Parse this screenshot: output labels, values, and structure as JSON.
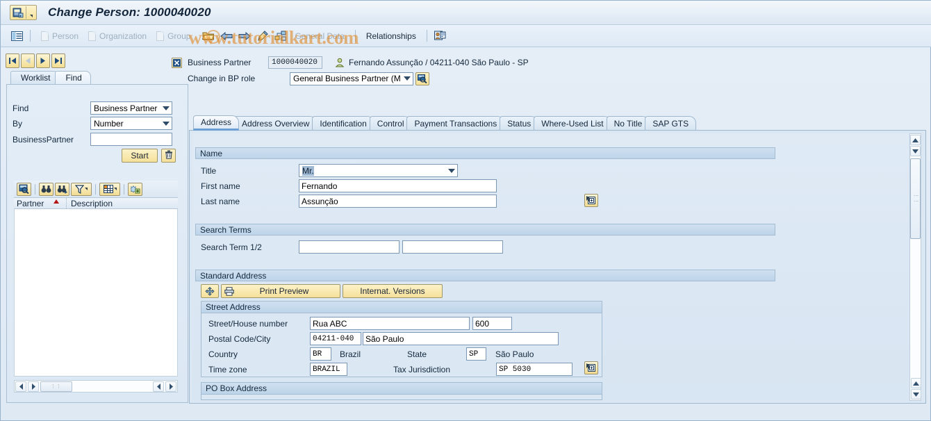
{
  "window": {
    "title": "Change Person: 1000040020",
    "sysmenu_icon": "bp-person-icon",
    "sysmenu_arrow_icon": "menu-dropdown-arrow-icon"
  },
  "watermark": {
    "text": "www.tutorialkart.com"
  },
  "app_toolbar": {
    "list_icon": "list-view-icon",
    "items": [
      {
        "label": "Person",
        "icon": "document-icon",
        "enabled": false
      },
      {
        "label": "Organization",
        "icon": "document-icon",
        "enabled": false
      },
      {
        "label": "Group",
        "icon": "document-icon",
        "enabled": false
      }
    ],
    "open_icon": "open-folder-icon",
    "back_icon": "left-arrow-icon",
    "forward_icon": "right-arrow-icon",
    "edit_icon": "pencil-edit-icon",
    "hierarchy_icon": "relationship-node-icon",
    "general_data_label": "General Data",
    "relationships_label": "Relationships",
    "bp_role_icon": "business-partner-card-icon"
  },
  "nav_buttons": [
    {
      "name": "first-record-button",
      "icon": "first-icon",
      "enabled": true
    },
    {
      "name": "previous-record-button",
      "icon": "previous-icon",
      "enabled": false
    },
    {
      "name": "next-record-button",
      "icon": "next-icon",
      "enabled": true
    },
    {
      "name": "last-record-button",
      "icon": "last-icon",
      "enabled": true
    }
  ],
  "left_panel": {
    "tabs": [
      {
        "label": "Worklist",
        "active": false
      },
      {
        "label": "Find",
        "active": true
      }
    ],
    "find_label": "Find",
    "find_value": "Business Partner",
    "by_label": "By",
    "by_value": "Number",
    "bp_label": "BusinessPartner",
    "bp_value": "",
    "start_label": "Start",
    "delete_icon": "trash-can-icon",
    "grid_toolbar": [
      {
        "name": "detail-search-button",
        "icon": "magnifier-detail-icon"
      },
      {
        "name": "find-button",
        "icon": "binoculars-icon"
      },
      {
        "name": "find-next-button",
        "icon": "binoculars-next-icon"
      },
      {
        "name": "filter-button",
        "icon": "filter-icon"
      },
      {
        "name": "layout-button",
        "icon": "table-layout-icon"
      },
      {
        "name": "refresh-button",
        "icon": "refresh-star-icon"
      }
    ],
    "columns": [
      "Partner",
      "Description"
    ],
    "rows": []
  },
  "bp_header": {
    "close_icon": "close-x-icon",
    "business_partner_label": "Business Partner",
    "business_partner_number": "1000040020",
    "person_icon": "person-icon",
    "summary": "Fernando Assunção / 04211-040 São Paulo - SP",
    "role_label": "Change in BP role",
    "role_value": "General Business Partner (M…",
    "role_search_icon": "search-magnifier-icon"
  },
  "main_tabs": [
    {
      "label": "Address",
      "active": true
    },
    {
      "label": "Address Overview",
      "active": false
    },
    {
      "label": "Identification",
      "active": false
    },
    {
      "label": "Control",
      "active": false
    },
    {
      "label": "Payment Transactions",
      "active": false
    },
    {
      "label": "Status",
      "active": false
    },
    {
      "label": "Where-Used List",
      "active": false
    },
    {
      "label": "No Title",
      "active": false
    },
    {
      "label": "SAP GTS",
      "active": false
    }
  ],
  "address_tab": {
    "name_group": {
      "title": "Name",
      "title_label": "Title",
      "title_value": "Mr.",
      "first_name_label": "First name",
      "first_name_value": "Fernando",
      "last_name_label": "Last name",
      "last_name_value": "Assunção",
      "help_icon": "value-help-icon"
    },
    "search_terms_group": {
      "title": "Search Terms",
      "search_term_label": "Search Term 1/2",
      "search_term_1": "",
      "search_term_2": ""
    },
    "standard_address_group": {
      "title": "Standard Address",
      "expand_icon": "expand-arrows-icon",
      "printer_icon": "printer-icon",
      "print_preview_label": "Print Preview",
      "internat_versions_label": "Internat. Versions"
    },
    "street_address_group": {
      "title": "Street Address",
      "street_label": "Street/House number",
      "street_value": "Rua ABC",
      "house_number_value": "600",
      "postal_city_label": "Postal Code/City",
      "postal_code_value": "04211-040",
      "city_value": "São Paulo",
      "country_label": "Country",
      "country_code": "BR",
      "country_name": "Brazil",
      "state_label": "State",
      "state_code": "SP",
      "state_name": "São Paulo",
      "timezone_label": "Time zone",
      "timezone_value": "BRAZIL",
      "tax_jurisdiction_label": "Tax Jurisdiction",
      "tax_jurisdiction_value": "SP 5030",
      "help_icon": "value-help-icon"
    },
    "po_box_group": {
      "title": "PO Box Address"
    }
  },
  "scrollbars": {
    "grip": "⋮⋮",
    "up_icon": "scroll-up-icon",
    "down_icon": "scroll-down-icon",
    "left_icon": "scroll-left-icon",
    "right_icon": "scroll-right-icon"
  },
  "colors": {
    "window_bg": "#dde9f4",
    "accent_blue": "#6b9fd4",
    "button_yellow": "#f5e09a",
    "group_header": "#bed4e9",
    "watermark_orange": "#e08b2a"
  }
}
